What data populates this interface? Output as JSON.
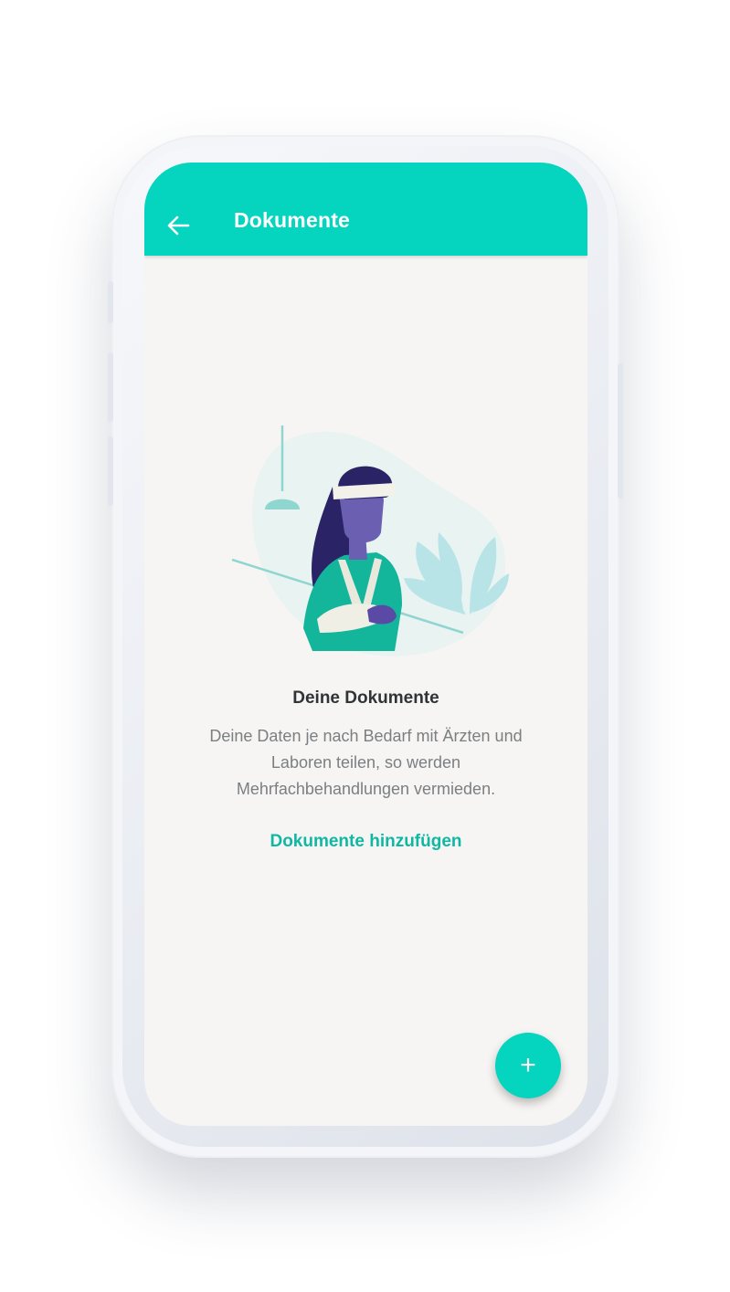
{
  "app_bar": {
    "back_icon": "arrow-left-icon",
    "title": "Dokumente"
  },
  "empty_state": {
    "illustration": "woman-with-arm-sling-illustration",
    "title": "Deine Dokumente",
    "description": "Deine Daten je nach Bedarf mit Ärzten und Laboren teilen, so werden Mehrfachbehandlungen vermieden.",
    "action_label": "Dokumente hinzufügen"
  },
  "fab": {
    "icon": "plus-icon",
    "symbol": "+"
  },
  "colors": {
    "accent": "#05d4bf",
    "link": "#10b8a4",
    "background": "#f6f5f3",
    "title_text": "#2f3437",
    "body_text": "#7b7f82"
  }
}
